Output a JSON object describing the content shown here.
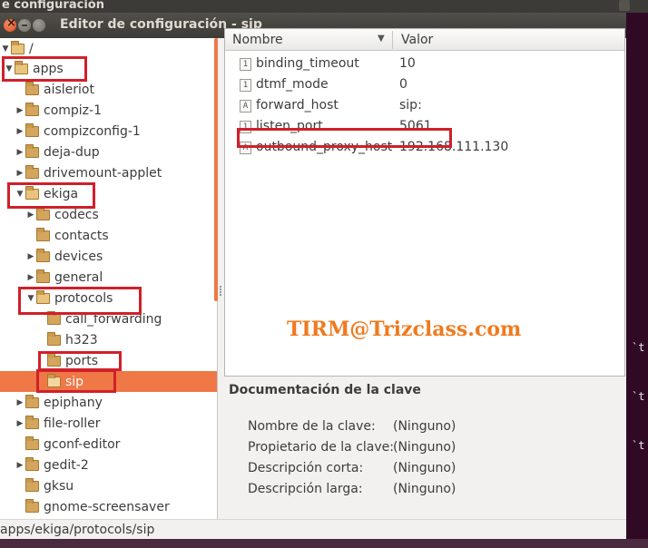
{
  "background_window": {
    "title": "e configuración",
    "terminal_marks": [
      "`t",
      "`t",
      "`t",
      "`t"
    ]
  },
  "window": {
    "title": "Editor de configuración - sip"
  },
  "tree": {
    "root": "/",
    "items": [
      {
        "label": "apps",
        "expanded": true
      },
      {
        "label": "aisleriot"
      },
      {
        "label": "compiz-1",
        "expander": true
      },
      {
        "label": "compizconfig-1",
        "expander": true
      },
      {
        "label": "deja-dup",
        "expander": true
      },
      {
        "label": "drivemount-applet",
        "expander": true
      },
      {
        "label": "ekiga",
        "expanded": true
      },
      {
        "label": "codecs",
        "expander": true
      },
      {
        "label": "contacts"
      },
      {
        "label": "devices",
        "expander": true
      },
      {
        "label": "general",
        "expander": true
      },
      {
        "label": "protocols",
        "expanded": true
      },
      {
        "label": "call_forwarding"
      },
      {
        "label": "h323"
      },
      {
        "label": "ports"
      },
      {
        "label": "sip",
        "selected": true
      },
      {
        "label": "epiphany",
        "expander": true
      },
      {
        "label": "file-roller",
        "expander": true
      },
      {
        "label": "gconf-editor"
      },
      {
        "label": "gedit-2",
        "expander": true
      },
      {
        "label": "gksu"
      },
      {
        "label": "gnome-screensaver"
      }
    ]
  },
  "table": {
    "columns": [
      "Nombre",
      "Valor"
    ],
    "rows": [
      {
        "icon": "1",
        "name": "binding_timeout",
        "value": "10"
      },
      {
        "icon": "1",
        "name": "dtmf_mode",
        "value": "0"
      },
      {
        "icon": "A",
        "name": "forward_host",
        "value": "sip:"
      },
      {
        "icon": "1",
        "name": "listen_port",
        "value": "5061"
      },
      {
        "icon": "A",
        "name": "outbound_proxy_host",
        "value": "192.168.111.130"
      }
    ]
  },
  "watermark": "TIRM@Trizclass.com",
  "documentation": {
    "title": "Documentación de la clave",
    "rows": [
      {
        "label": "Nombre de la clave:",
        "value": "(Ninguno)"
      },
      {
        "label": "Propietario de la clave:",
        "value": "(Ninguno)"
      },
      {
        "label": "Descripción corta:",
        "value": "(Ninguno)"
      },
      {
        "label": "Descripción larga:",
        "value": "(Ninguno)"
      }
    ]
  },
  "status": "apps/ekiga/protocols/sip",
  "colors": {
    "selection": "#f07746",
    "annotation": "#d0202a",
    "watermark": "#f07a1e"
  },
  "icons": [
    "close-icon",
    "minimize-icon",
    "maximize-icon",
    "folder-icon",
    "expander-arrow-icon",
    "integer-type-icon",
    "string-type-icon"
  ]
}
